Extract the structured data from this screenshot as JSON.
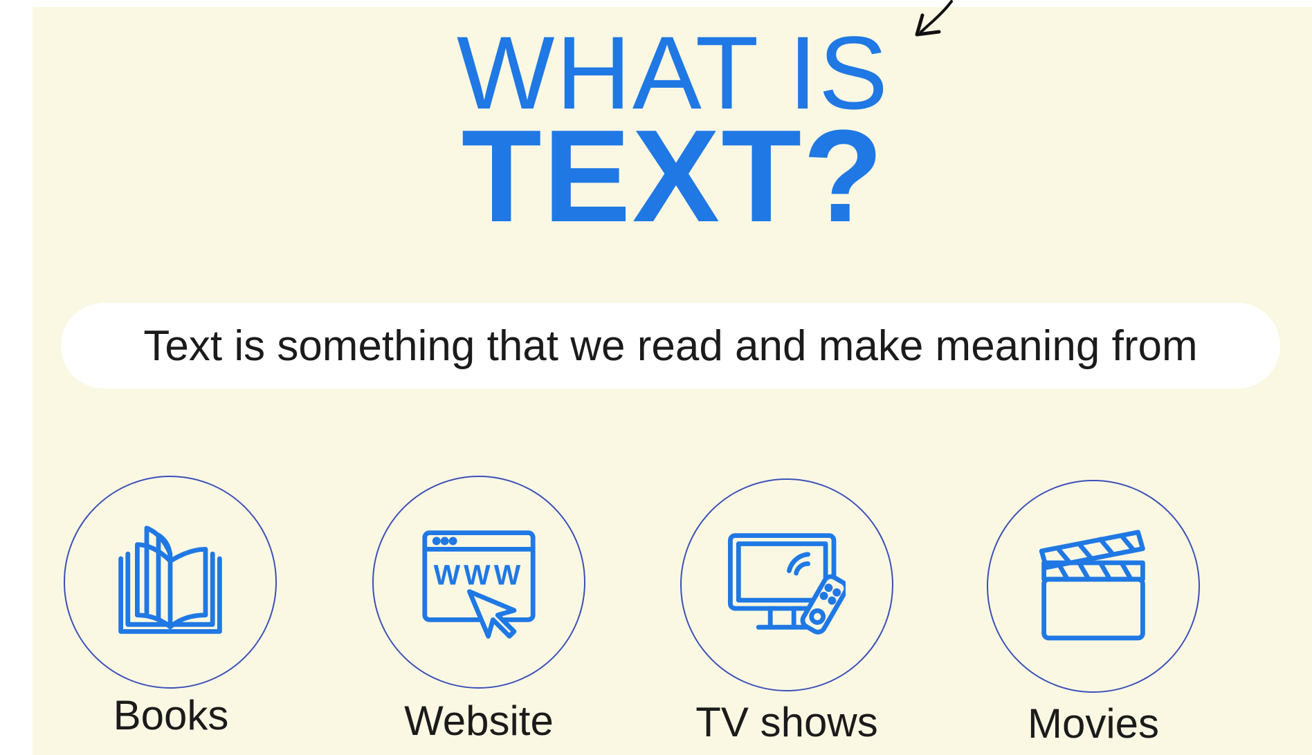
{
  "title": {
    "line1": "WHAT IS",
    "line2": "TEXT?"
  },
  "definition": "Text is something that we read and make meaning from",
  "items": [
    {
      "label": "Books",
      "icon": "book-icon"
    },
    {
      "label": "Website",
      "icon": "website-icon",
      "icon_text": "WWW"
    },
    {
      "label": "TV shows",
      "icon": "tv-remote-icon"
    },
    {
      "label": "Movies",
      "icon": "clapperboard-icon"
    }
  ],
  "colors": {
    "accent": "#1f78e4",
    "background": "#faf8e3",
    "circle_border": "#3a4fb8",
    "text": "#1b1b1b"
  }
}
